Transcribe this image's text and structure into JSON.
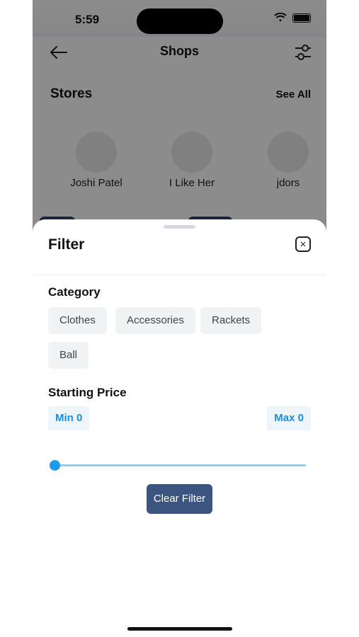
{
  "status_bar": {
    "time": "5:59"
  },
  "appbar": {
    "title": "Shops"
  },
  "stores_section": {
    "title": "Stores",
    "see_all": "See All",
    "items": [
      {
        "name": "Joshi Patel"
      },
      {
        "name": "I Like Her"
      },
      {
        "name": "jdors"
      }
    ]
  },
  "filter_sheet": {
    "title": "Filter",
    "category": {
      "label": "Category",
      "options": [
        "Clothes",
        "Accessories",
        "Rackets",
        "Ball"
      ]
    },
    "starting_price": {
      "label": "Starting Price",
      "min_label": "Min 0",
      "max_label": "Max 0",
      "slider_value": 0
    },
    "clear_button": "Clear Filter"
  },
  "colors": {
    "accent": "#1e9bea",
    "primary_button": "#3b5580"
  }
}
